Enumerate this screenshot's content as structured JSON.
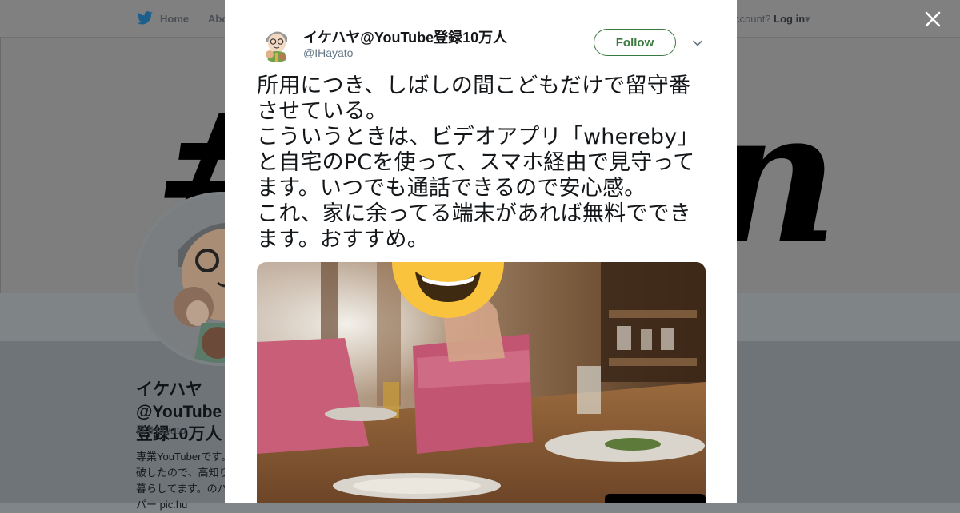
{
  "background_page": {
    "nav": {
      "home_label": "Home",
      "about_label": "Abo",
      "account_prompt": "ccount?",
      "login_label": "Log in"
    },
    "profile": {
      "name": "イケハヤ@YouTube登録10万人",
      "handle": "@IHayato",
      "bio": "専業YouTuberです。破したので、高知り暮らしてます。のパパー pic.hu"
    }
  },
  "tweet": {
    "author_name": "イケハヤ@YouTube登録10万人",
    "author_handle": "@IHayato",
    "follow_label": "Follow",
    "text": "所用につき、しばしの間こどもだけで留守番させている。\nこういうときは、ビデオアプリ「whereby」と自宅のPCを使って、スマホ経由で見守ってます。いつでも通話できるので安心感。\nこれ、家に余ってる端末があれば無料でできます。おすすめ。"
  },
  "icons": {
    "twitter_bird": "bird-icon",
    "close": "close-icon",
    "more": "chevron-down-icon"
  },
  "colors": {
    "follow_accent": "#3b7a3f",
    "overlay": "#7f8588",
    "emoji_yellow": "#f9c33d"
  }
}
